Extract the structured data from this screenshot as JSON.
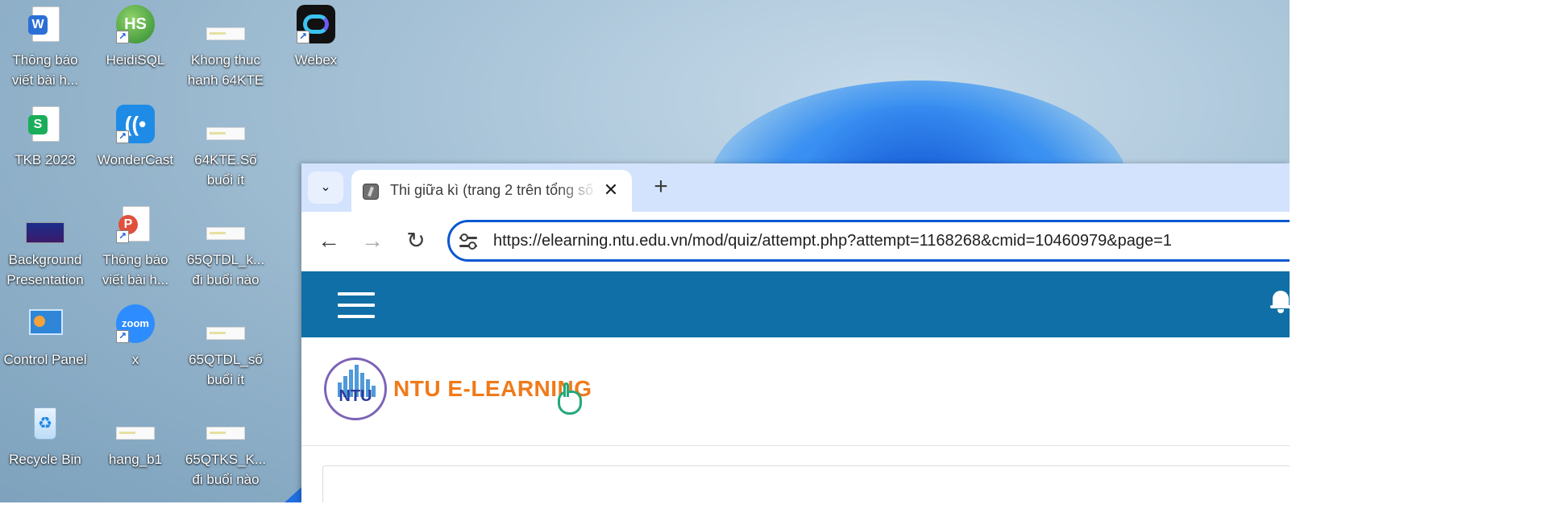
{
  "desktop": {
    "icons": [
      {
        "label": "Thông báo\nviết bài h...",
        "icon": "word-doc-icon",
        "accent": "#2b6fd6"
      },
      {
        "label": "HeidiSQL",
        "icon": "heidisql-icon",
        "accent": "#3a9a3a"
      },
      {
        "label": "Khong thuc\nhanh 64KTE",
        "icon": "spreadsheet-thumbnail-icon"
      },
      {
        "label": "Webex",
        "icon": "webex-icon",
        "accent": "#111111"
      },
      {
        "label": "TKB 2023",
        "icon": "wps-sheet-icon",
        "accent": "#1aae5a"
      },
      {
        "label": "WonderCast",
        "icon": "wondercast-icon",
        "accent": "#1e8be6"
      },
      {
        "label": "64KTE.Số\nbuổi ít",
        "icon": "spreadsheet-thumbnail-icon"
      },
      {
        "label": "Background\nPresentation",
        "icon": "presentation-thumbnail-icon"
      },
      {
        "label": "Thông báo\nviết bài h...",
        "icon": "pdf-doc-icon",
        "accent": "#e0503c"
      },
      {
        "label": "65QTDL_k...\nđi buổi nào",
        "icon": "spreadsheet-thumbnail-icon"
      },
      {
        "label": "Control Panel",
        "icon": "control-panel-icon",
        "accent": "#2f86d8"
      },
      {
        "label": "x",
        "icon": "zoom-icon",
        "accent": "#2d8cff"
      },
      {
        "label": "65QTDL_số\nbuổi ít",
        "icon": "spreadsheet-thumbnail-icon"
      },
      {
        "label": "Recycle Bin",
        "icon": "recycle-bin-icon",
        "accent": "#3aa0e8"
      },
      {
        "label": "hang_b1",
        "icon": "spreadsheet-thumbnail-icon"
      },
      {
        "label": "65QTKS_K...\nđi buổi nào",
        "icon": "spreadsheet-thumbnail-icon"
      }
    ],
    "icon_glyphs": {
      "word": "W",
      "heidi": "HS",
      "wps": "S",
      "zoom": "zoom"
    }
  },
  "browser": {
    "tab": {
      "title": "Thi giữa kì (trang 2 trên tổng số",
      "close_glyph": "✕"
    },
    "new_tab_glyph": "+",
    "tab_search_glyph": "⌄",
    "nav": {
      "back": "←",
      "forward": "→",
      "reload": "↻"
    },
    "address_bar": {
      "url": "https://elearning.ntu.edu.vn/mod/quiz/attempt.php?attempt=1168268&cmid=10460979&page=1"
    }
  },
  "site": {
    "header_color": "#0f6fa6",
    "logo": {
      "badge_text": "NTU",
      "brand_text": "NTU E-LEARNING",
      "brand_color": "#f07a1a"
    }
  },
  "colors": {
    "tabstrip": "#d3e3fd",
    "omnibox_focus": "#0b57d0"
  }
}
